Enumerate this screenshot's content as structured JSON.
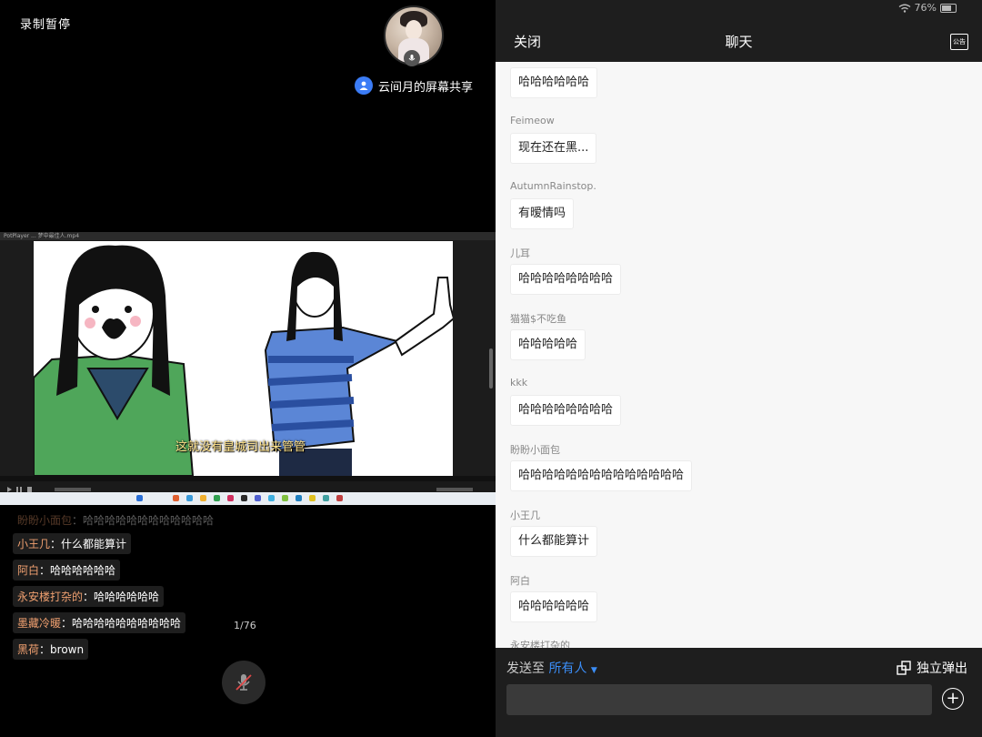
{
  "left": {
    "record_label": "录制暂停",
    "share_label": "云间月的屏幕共享",
    "video": {
      "window_title": "PotPlayer  ...  梦中最佳人.mp4",
      "subtitle": "这就没有皇城司出来管管"
    },
    "overlay_chat": [
      {
        "name": "盼盼小面包",
        "sep": "：",
        "text": "哈哈哈哈哈哈哈哈哈哈哈哈",
        "faded": true
      },
      {
        "name": "小王几",
        "sep": "：",
        "text": "什么都能算计"
      },
      {
        "name": "阿白",
        "sep": "：",
        "text": "哈哈哈哈哈哈"
      },
      {
        "name": "永安楼打杂的",
        "sep": "：",
        "text": "哈哈哈哈哈哈"
      },
      {
        "name": "墨藏冷暖",
        "sep": "：",
        "text": "哈哈哈哈哈哈哈哈哈哈"
      },
      {
        "name": "黑荷",
        "sep": "：",
        "text": "brown"
      }
    ],
    "page_counter": "1/76"
  },
  "right": {
    "status": {
      "battery_text": "76%"
    },
    "header": {
      "close_label": "关闭",
      "title": "聊天",
      "notice_label": "公告"
    },
    "messages": [
      {
        "name": "",
        "text": "哈哈哈哈哈哈"
      },
      {
        "name": "Feimeow",
        "text": "现在还在黑..."
      },
      {
        "name": "AutumnRainstop.",
        "text": "有暧情吗"
      },
      {
        "name": "儿耳",
        "text": "哈哈哈哈哈哈哈哈"
      },
      {
        "name": "猫猫$不吃鱼",
        "text": "哈哈哈哈哈"
      },
      {
        "name": "kkk",
        "text": "哈哈哈哈哈哈哈哈"
      },
      {
        "name": "盼盼小面包",
        "text": "哈哈哈哈哈哈哈哈哈哈哈哈哈哈"
      },
      {
        "name": "小王几",
        "text": "什么都能算计"
      },
      {
        "name": "阿白",
        "text": "哈哈哈哈哈哈"
      },
      {
        "name": "永安楼打杂的",
        "text": ""
      }
    ],
    "footer": {
      "send_to_label": "发送至",
      "send_to_target": "所有人",
      "popout_label": "独立弹出",
      "input_placeholder": ""
    }
  }
}
